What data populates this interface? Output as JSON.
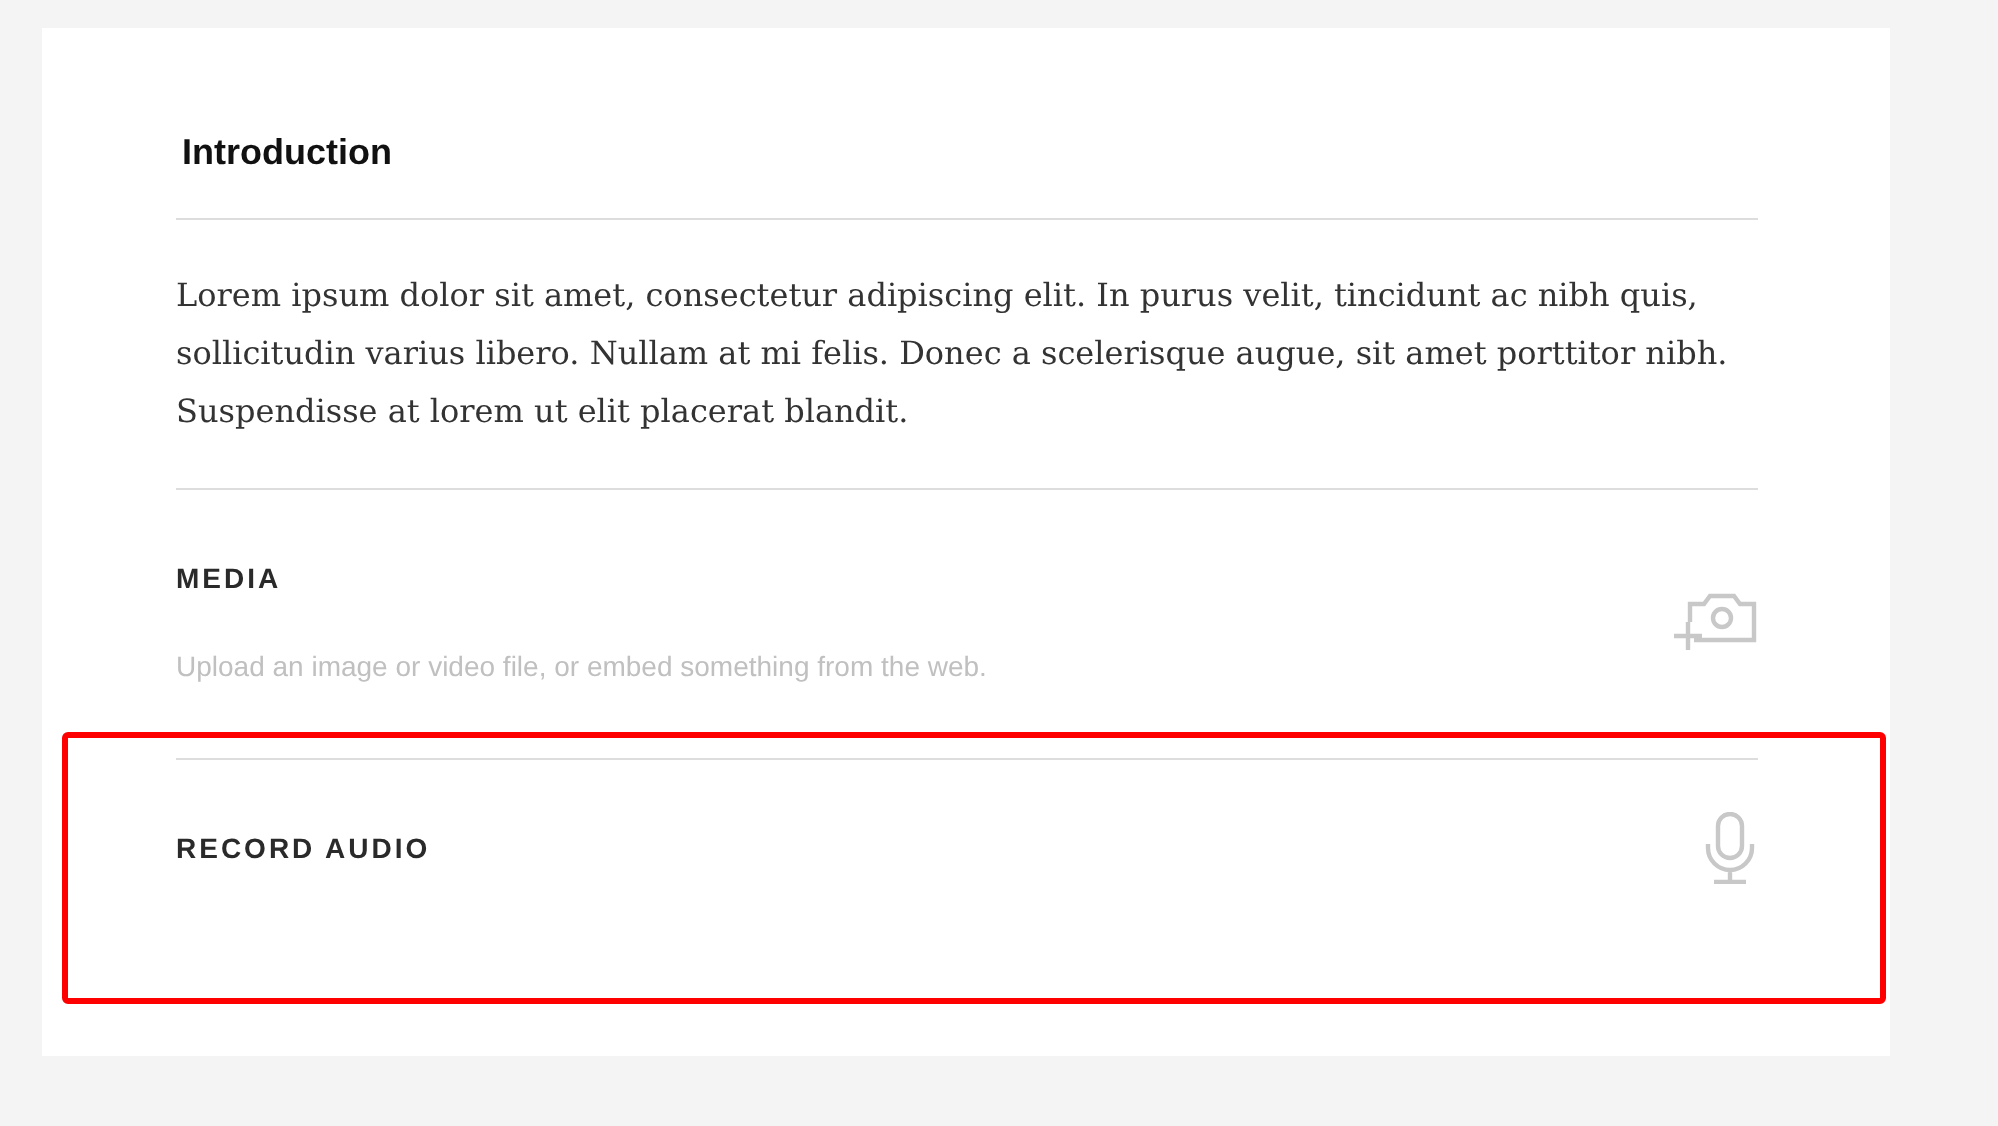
{
  "intro": {
    "title": "Introduction",
    "body": "Lorem ipsum dolor sit amet, consectetur adipiscing elit. In purus velit, tincidunt ac nibh quis, sollicitudin varius libero. Nullam at mi felis. Donec a scelerisque augue, sit amet porttitor nibh. Suspendisse at lorem ut elit placerat blandit."
  },
  "sections": [
    {
      "kind": "media",
      "label": "MEDIA",
      "hint": "Upload an image or video file, or embed something from the web.",
      "highlighted": false
    },
    {
      "kind": "audio",
      "label": "RECORD AUDIO",
      "highlighted": true
    }
  ]
}
